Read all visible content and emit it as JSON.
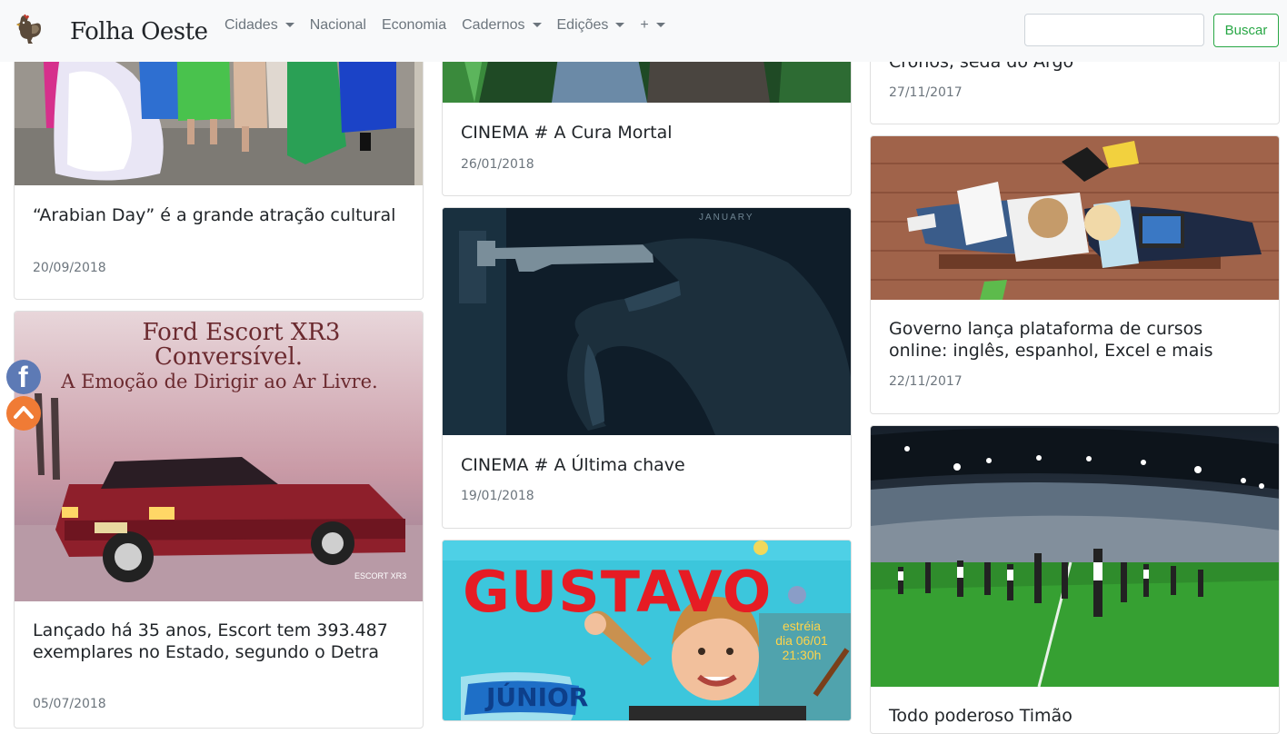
{
  "navbar": {
    "brand": "Folha Oeste",
    "items": [
      {
        "label": "Cidades",
        "dropdown": true
      },
      {
        "label": "Nacional",
        "dropdown": false
      },
      {
        "label": "Economia",
        "dropdown": false
      },
      {
        "label": "Cadernos",
        "dropdown": true
      },
      {
        "label": "Edições",
        "dropdown": true
      },
      {
        "label": "+",
        "dropdown": true
      }
    ],
    "search_value": "",
    "search_button": "Buscar",
    "button_color": "#28a745"
  },
  "columns": {
    "left": [
      {
        "title": "“Arabian Day” é a grande atração cultural",
        "date": "20/09/2018"
      },
      {
        "title": "Lançado há 35 anos, Escort tem 393.487 exemplares no Estado, segundo o Detra",
        "date": "05/07/2018",
        "ad_line1": "Ford Escort XR3",
        "ad_line2": "Conversível.",
        "ad_line3": "A Emoção de Dirigir ao Ar Livre."
      }
    ],
    "middle": [
      {
        "title": "CINEMA # A Cura Mortal",
        "date": "26/01/2018"
      },
      {
        "title": "CINEMA # A Última chave",
        "date": "19/01/2018",
        "poster_text": "JANUARY"
      },
      {
        "poster_name": "GUSTAVO",
        "poster_sub": "JÚNIOR",
        "poster_badge_1": "estréia",
        "poster_badge_2": "dia 06/01",
        "poster_badge_3": "21:30h"
      }
    ],
    "right": [
      {
        "title": "Cronos, seda do Argo",
        "date": "27/11/2017"
      },
      {
        "title": "Governo lança plataforma de cursos online: inglês, espanhol, Excel e mais",
        "date": "22/11/2017"
      },
      {
        "title": "Todo poderoso Timão"
      }
    ]
  },
  "social": {
    "facebook": "f",
    "facebook_color": "#5d7ab5",
    "top_color": "#f07b35"
  }
}
